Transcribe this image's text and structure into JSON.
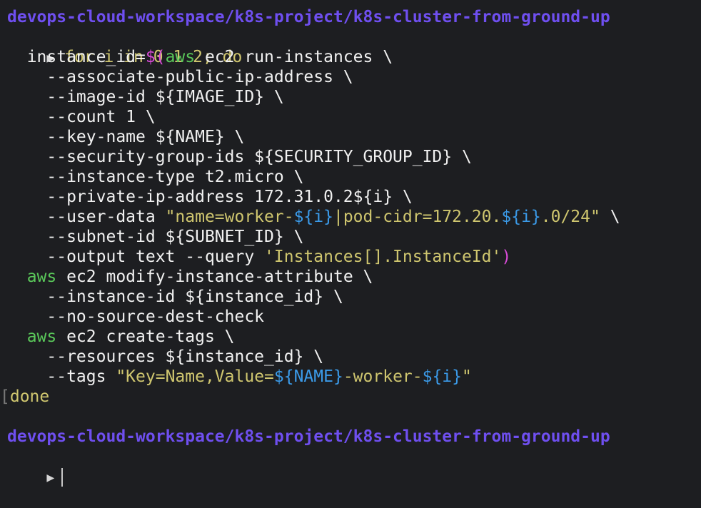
{
  "colors": {
    "background": "#1d1e21",
    "prompt": "#6f4ff0",
    "keyword": "#cfc66f",
    "command": "#5ac85a",
    "string": "#cfc66f",
    "variable": "#3b9ae8",
    "substitution": "#d94bd8",
    "text": "#f1f1f1"
  },
  "prompt": {
    "path": "devops-cloud-workspace/k8s-project/k8s-cluster-from-ground-up",
    "arrow_icon": "triangle-right"
  },
  "code": {
    "l1_for": "for i in 0 1 2;",
    "l1_do": " do",
    "l2_a": "  instance_id=",
    "l2_subst_open": "$(",
    "l2_aws": "aws",
    "l2_rest": " ec2 run-instances \\",
    "l3": "    --associate-public-ip-address \\",
    "l4": "    --image-id ${IMAGE_ID} \\",
    "l5": "    --count 1 \\",
    "l6": "    --key-name ${NAME} \\",
    "l7": "    --security-group-ids ${SECURITY_GROUP_ID} \\",
    "l8": "    --instance-type t2.micro \\",
    "l9": "    --private-ip-address 172.31.0.2${i} \\",
    "l10_a": "    --user-data ",
    "l10_str1": "\"name=worker-",
    "l10_var1": "${i}",
    "l10_str2": "|pod-cidr=172.20.",
    "l10_var2": "${i}",
    "l10_str3": ".0/24\"",
    "l10_end": " \\",
    "l11": "    --subnet-id ${SUBNET_ID} \\",
    "l12_a": "    --output text --query ",
    "l12_str": "'Instances[].InstanceId'",
    "l12_close": ")",
    "l13_aws": "  aws",
    "l13_rest": " ec2 modify-instance-attribute \\",
    "l14": "    --instance-id ${instance_id} \\",
    "l15": "    --no-source-dest-check",
    "l16_aws": "  aws",
    "l16_rest": " ec2 create-tags \\",
    "l17": "    --resources ${instance_id} \\",
    "l18_a": "    --tags ",
    "l18_str1": "\"Key=Name,Value=",
    "l18_var1": "${NAME}",
    "l18_str2": "-worker-",
    "l18_var2": "${i}",
    "l18_str3": "\"",
    "l19_bracket": "[",
    "l19_done": "done"
  }
}
